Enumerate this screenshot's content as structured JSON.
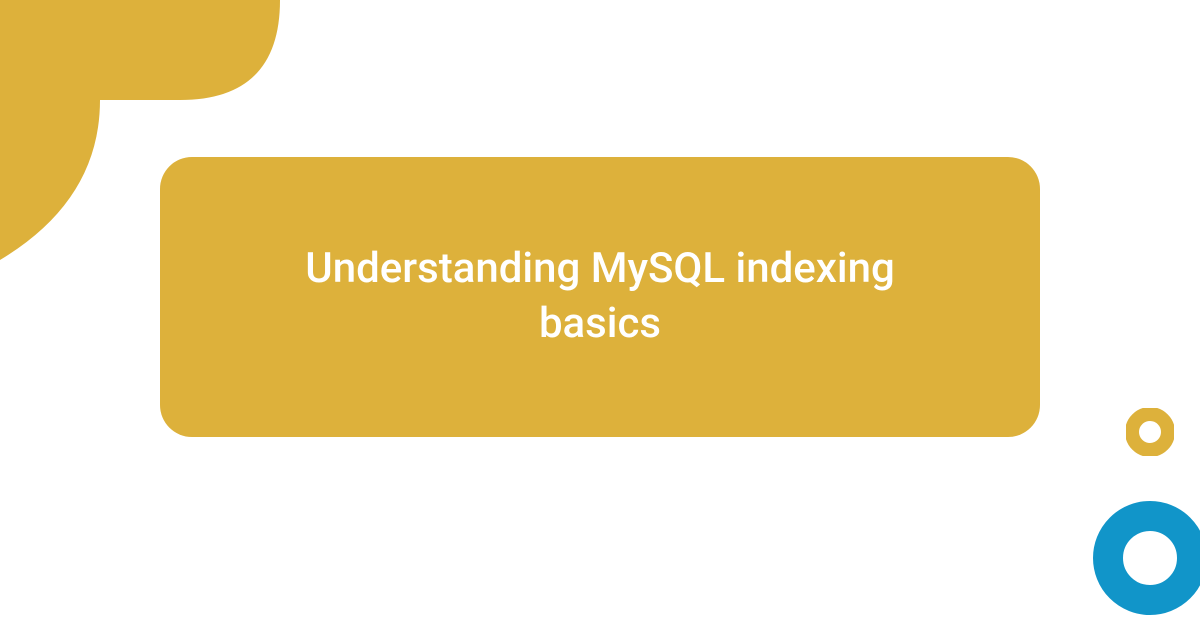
{
  "title": "Understanding MySQL indexing basics",
  "colors": {
    "gold": "#ddb13b",
    "blue": "#1195c9",
    "white": "#ffffff"
  }
}
